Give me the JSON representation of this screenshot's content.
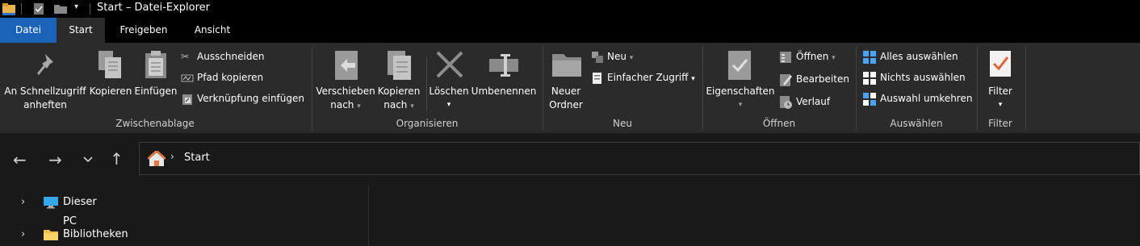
{
  "window": {
    "title": "Start – Datei-Explorer"
  },
  "tabs": [
    {
      "label": "Datei"
    },
    {
      "label": "Start"
    },
    {
      "label": "Freigeben"
    },
    {
      "label": "Ansicht"
    }
  ],
  "ribbon": {
    "clipboard": {
      "label": "Zwischenablage",
      "pin_line1": "An Schnellzugriff",
      "pin_line2": "anheften",
      "copy": "Kopieren",
      "paste": "Einfügen",
      "cut": "Ausschneiden",
      "copy_path": "Pfad kopieren",
      "paste_shortcut": "Verknüpfung einfügen"
    },
    "organize": {
      "label": "Organisieren",
      "move_line1": "Verschieben",
      "move_line2": "nach",
      "copyto_line1": "Kopieren",
      "copyto_line2": "nach",
      "delete": "Löschen",
      "rename": "Umbenennen"
    },
    "new": {
      "label": "Neu",
      "folder_line1": "Neuer",
      "folder_line2": "Ordner",
      "new_item": "Neu",
      "easy_access": "Einfacher Zugriff"
    },
    "open": {
      "label": "Öffnen",
      "properties": "Eigenschaften",
      "open": "Öffnen",
      "edit": "Bearbeiten",
      "history": "Verlauf"
    },
    "select": {
      "label": "Auswählen",
      "select_all": "Alles auswählen",
      "select_none": "Nichts auswählen",
      "invert": "Auswahl umkehren"
    },
    "filter": {
      "label": "Filter",
      "button": "Filter"
    }
  },
  "address": {
    "path": "Start"
  },
  "tree": [
    {
      "label": "Dieser PC"
    },
    {
      "label": "Bibliotheken"
    }
  ],
  "colors": {
    "accent": "#1a63b8",
    "background": "#191919",
    "ribbon": "#2b2b2b"
  }
}
